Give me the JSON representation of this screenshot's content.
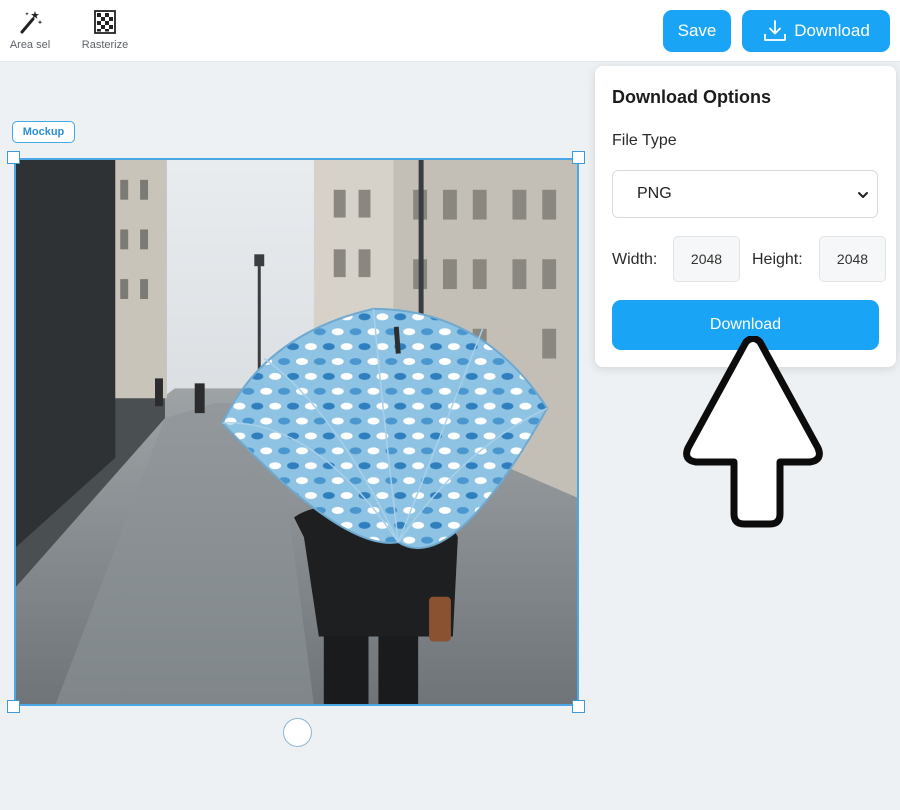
{
  "toolbar": {
    "tools": [
      {
        "label": "Area sel",
        "icon": "magic-wand-icon"
      },
      {
        "label": "Rasterize",
        "icon": "rasterize-grid-icon"
      }
    ],
    "save_label": "Save",
    "download_label": "Download",
    "download_icon": "download-tray-icon"
  },
  "canvas": {
    "tag_label": "Mockup",
    "image_description_icon": "mockup-photo"
  },
  "download_panel": {
    "title": "Download Options",
    "file_type_label": "File Type",
    "file_type_value": "PNG",
    "width_label": "Width:",
    "width_value": "2048",
    "height_label": "Height:",
    "height_value": "2048",
    "download_button_label": "Download"
  },
  "colors": {
    "accent": "#1aa4f5",
    "selection": "#4aa9e4",
    "canvas_bg": "#eef1f3"
  }
}
